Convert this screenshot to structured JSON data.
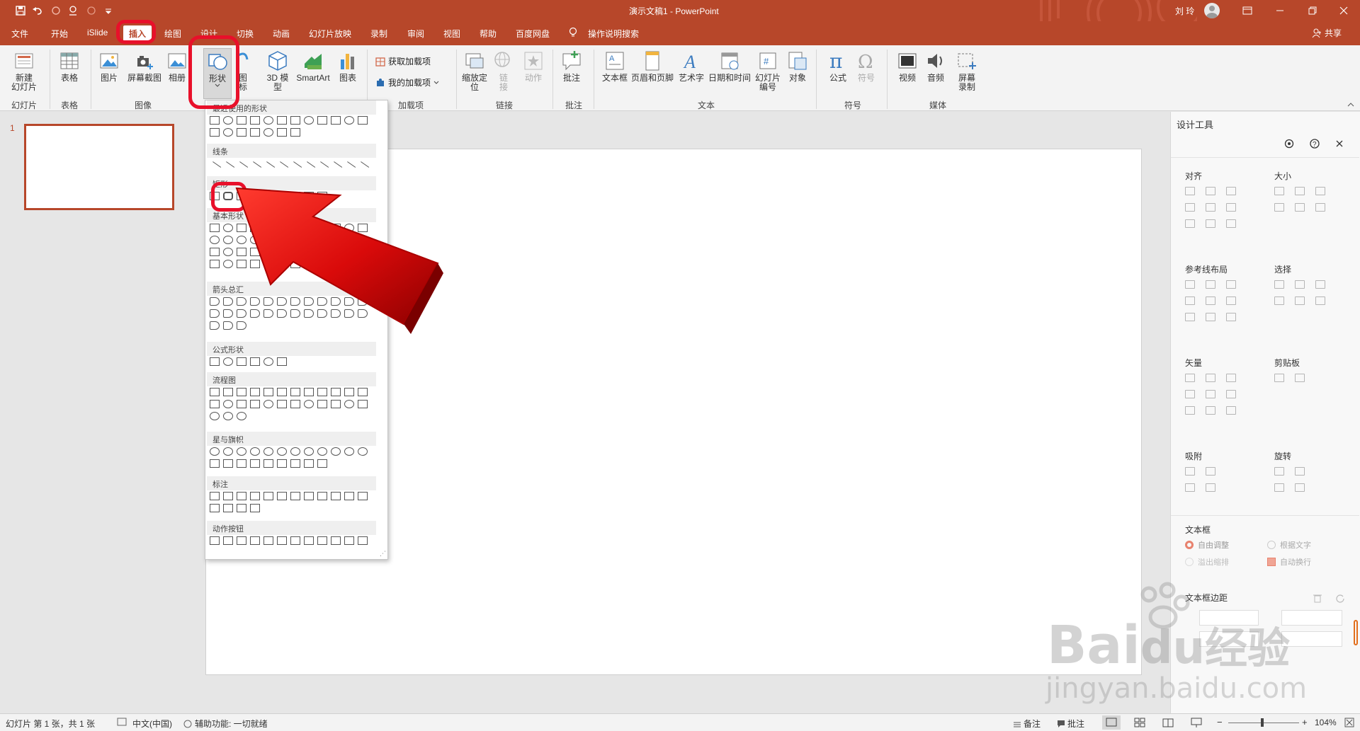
{
  "titlebar": {
    "doc_title": "演示文稿1",
    "app_name": "PowerPoint",
    "user": "刘 玲"
  },
  "tabs": [
    "文件",
    "开始",
    "iSlide",
    "插入",
    "绘图",
    "设计",
    "切换",
    "动画",
    "幻灯片放映",
    "录制",
    "审阅",
    "视图",
    "帮助",
    "百度网盘"
  ],
  "active_tab": "插入",
  "search_label": "操作说明搜索",
  "share_label": "共享",
  "ribbon": {
    "new_slide": "新建\n幻灯片",
    "table": "表格",
    "picture": "图片",
    "screenshot": "屏幕截图",
    "album": "相册",
    "shapes": "形状",
    "icons": "图\n标",
    "model3d": "3D 模\n型",
    "smartart": "SmartArt",
    "chart": "图表",
    "get_addins": "获取加载项",
    "my_addins": "我的加载项",
    "zoom": "缩放定\n位",
    "link": "链\n接",
    "action": "动作",
    "comment": "批注",
    "textbox": "文本框",
    "header_footer": "页眉和页脚",
    "wordart": "艺术字",
    "datetime": "日期和时间",
    "slide_number": "幻灯片\n编号",
    "object": "对象",
    "equation": "公式",
    "symbol": "符号",
    "video": "视频",
    "audio": "音频",
    "screen_record": "屏幕\n录制",
    "groups": {
      "slides": "幻灯片",
      "tables": "表格",
      "images": "图像",
      "addins": "加载项",
      "links": "链接",
      "comments": "批注",
      "text": "文本",
      "symbols": "符号",
      "media": "媒体"
    }
  },
  "shapes_gallery": {
    "sections": [
      "最近使用的形状",
      "线条",
      "矩形",
      "基本形状",
      "箭头总汇",
      "公式形状",
      "流程图",
      "星与旗帜",
      "标注",
      "动作按钮"
    ]
  },
  "thumbnail": {
    "number": "1"
  },
  "design_panel": {
    "title": "设计工具",
    "sections": {
      "align": "对齐",
      "size": "大小",
      "guides": "参考线布局",
      "select": "选择",
      "vector": "矢量",
      "clipboard": "剪贴板",
      "snap": "吸附",
      "rotate": "旋转",
      "textbox": "文本框",
      "margin": "文本框边距"
    },
    "opt_free": "自由调整",
    "opt_fit": "根据文字",
    "opt_overflow": "溢出缩排",
    "opt_wrap": "自动换行"
  },
  "statusbar": {
    "slide_info": "幻灯片 第 1 张，共 1 张",
    "language": "中文(中国)",
    "accessibility": "辅助功能: 一切就绪",
    "notes": "备注",
    "comments": "批注",
    "zoom": "104%"
  },
  "watermark": {
    "text1": "Bai",
    "text2": "du",
    "text3": "经验",
    "url": "jingyan.baidu.com"
  },
  "colors": {
    "accent": "#b7472a",
    "highlight": "#e8102a"
  }
}
